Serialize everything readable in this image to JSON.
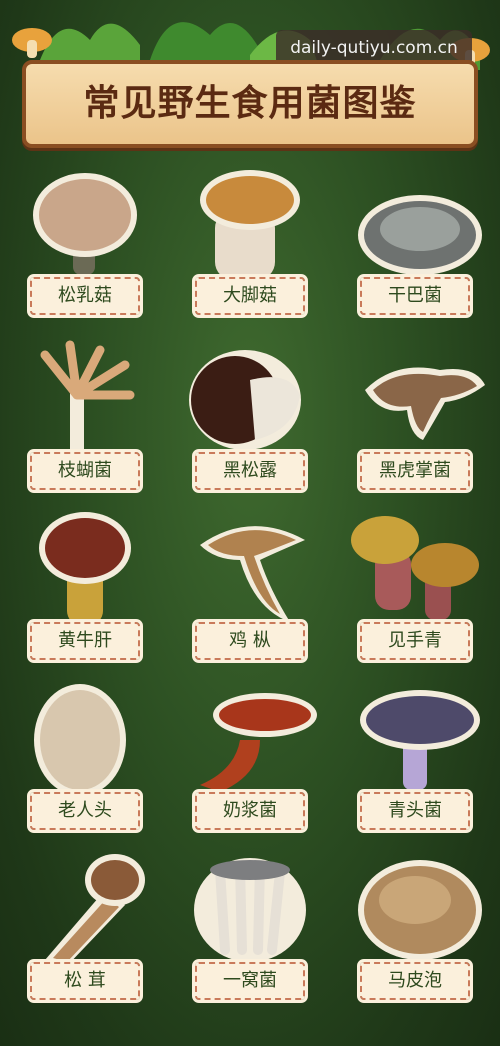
{
  "watermark": "daily-qutiyu.com.cn",
  "title": "常见野生食用菌图鉴",
  "mushrooms": [
    {
      "name": "松乳菇"
    },
    {
      "name": "大脚菇"
    },
    {
      "name": "干巴菌"
    },
    {
      "name": "枝蝴菌"
    },
    {
      "name": "黑松露"
    },
    {
      "name": "黑虎掌菌"
    },
    {
      "name": "黄牛肝"
    },
    {
      "name": "鸡  枞"
    },
    {
      "name": "见手青"
    },
    {
      "name": "老人头"
    },
    {
      "name": "奶浆菌"
    },
    {
      "name": "青头菌"
    },
    {
      "name": "松  茸"
    },
    {
      "name": "一窝菌"
    },
    {
      "name": "马皮泡"
    }
  ]
}
